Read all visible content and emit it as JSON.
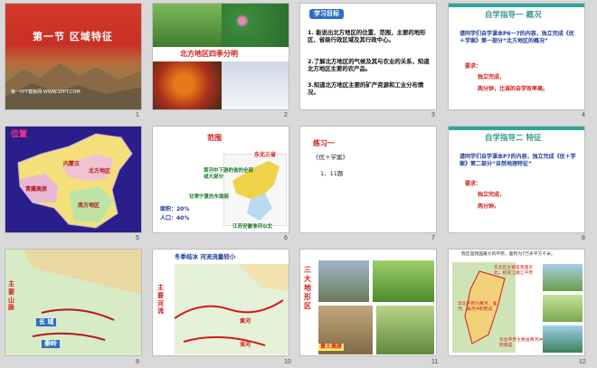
{
  "slides": [
    {
      "number": "1",
      "title": "第一节  区域特征",
      "footer": "第一PPT模板网-WWW.1PPT.COM"
    },
    {
      "number": "2",
      "banner": "北方地区四季分明"
    },
    {
      "number": "3",
      "badge": "学习目标",
      "items": [
        "1. 能说出北方地区的位置、范围，主要的地形区、省级行政区域及其行政中心。",
        "2.了解北方地区的气候及其与农业的关系，知道北方地区主要的农产品。",
        "3.知道北方地区主要的矿产资源和工业分布情况。"
      ]
    },
    {
      "number": "4",
      "title": "自学指导一  概况",
      "body": "请同学们自学课本P6一7的内容，独立完成《优＋学案》第一部分“北方地区的概况”",
      "req_label": "要求：",
      "req1": "独立完成，",
      "req2": "两分钟，比谁的自学效率高。"
    },
    {
      "number": "5",
      "label": "位置",
      "map_labels": [
        "内蒙古",
        "北方地区",
        "青藏高原",
        "南方地区"
      ]
    },
    {
      "number": "6",
      "title": "范围",
      "north": "东北三省",
      "ann1": "黄河中下游的省的全部或大部分",
      "ann2": "甘肃宁夏的东南部",
      "area": "面积：20%",
      "pop": "人口：40%",
      "river": "江苏安徽淮河以北"
    },
    {
      "number": "7",
      "title": "练习一",
      "line1": "《优＋学案》",
      "line2": "1、11题"
    },
    {
      "number": "8",
      "title": "自学指导二  特征",
      "body": "请同学们自学课本P7的内容，独立完成《优＋学案》第二部分“自然地理特征”",
      "req_label": "要求：",
      "req1": "独立完成，",
      "req2": "两分钟。"
    },
    {
      "number": "9",
      "side": "主要山脉",
      "labels": [
        "长 城",
        "秦岭"
      ]
    },
    {
      "number": "10",
      "top": "冬季结冰   河流流量较小",
      "side": "主要河流",
      "labels": [
        "黄河",
        "淮河"
      ]
    },
    {
      "number": "11",
      "side": "三大地形区",
      "labels": [
        "黄土高原"
      ]
    },
    {
      "number": "12",
      "note1": "我区是我国最大的平原，面积为7万多平方千米。",
      "note2": "东北区主要是我国东北，松花江嫩江平原",
      "note3": "华北平原为黄河、淮河、海河冲积而成",
      "note4": "华北平原主要由黄河冲积而成"
    }
  ],
  "colors": {
    "accent": "#d41a1a",
    "teal": "#2fa59a",
    "blue": "#1e3c9a"
  }
}
